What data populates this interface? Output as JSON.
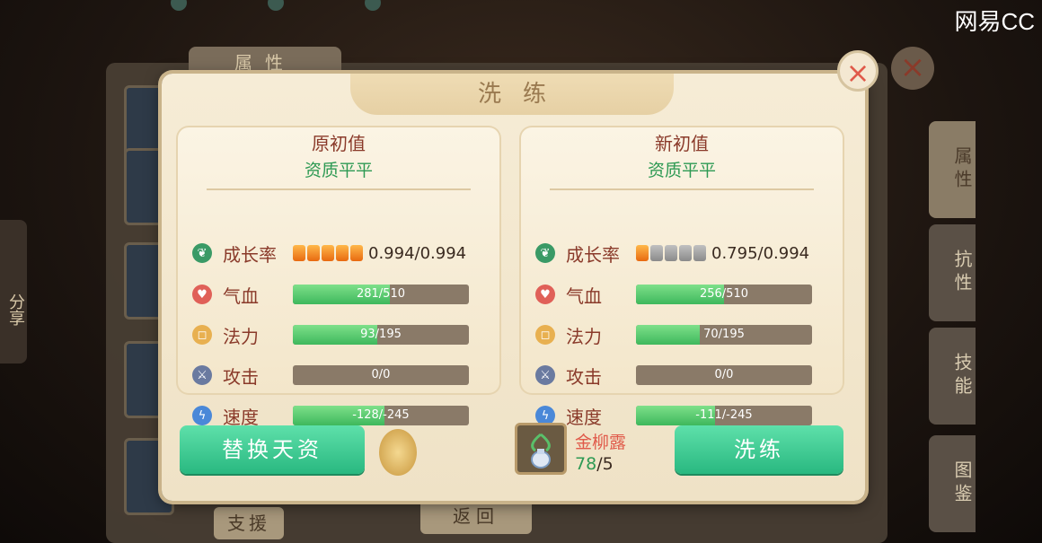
{
  "watermark": "网易CC",
  "background": {
    "title_tab": "属性",
    "support_button": "支援",
    "return_button": "返回",
    "share_tab": "分享",
    "side_tabs": [
      "属性",
      "抗性",
      "技能",
      "图鉴"
    ]
  },
  "dialog": {
    "title": "洗练",
    "original": {
      "heading": "原初值",
      "grade": "资质平平",
      "growth": {
        "label": "成长率",
        "value": "0.994/0.994",
        "pips_on": 5,
        "pips_total": 5
      },
      "stats": [
        {
          "key": "hp",
          "label": "气血",
          "text": "281/510",
          "fill": 0.55
        },
        {
          "key": "mp",
          "label": "法力",
          "text": "93/195",
          "fill": 0.48
        },
        {
          "key": "atk",
          "label": "攻击",
          "text": "0/0",
          "fill": 0
        },
        {
          "key": "spd",
          "label": "速度",
          "text": "-128/-245",
          "fill": 0.52
        }
      ]
    },
    "new": {
      "heading": "新初值",
      "grade": "资质平平",
      "growth": {
        "label": "成长率",
        "value": "0.795/0.994",
        "pips_on": 1,
        "pips_total": 5
      },
      "stats": [
        {
          "key": "hp",
          "label": "气血",
          "text": "256/510",
          "fill": 0.5
        },
        {
          "key": "mp",
          "label": "法力",
          "text": "70/195",
          "fill": 0.36
        },
        {
          "key": "atk",
          "label": "攻击",
          "text": "0/0",
          "fill": 0
        },
        {
          "key": "spd",
          "label": "速度",
          "text": "-111/-245",
          "fill": 0.45
        }
      ]
    },
    "replace_button": "替换天资",
    "refine_button": "洗练",
    "item": {
      "name": "金柳露",
      "have": "78",
      "need": "/5"
    },
    "colors": {
      "accent_green": "#29b880",
      "label_red": "#8a3a2a",
      "grade_green": "#2e9a54"
    }
  }
}
